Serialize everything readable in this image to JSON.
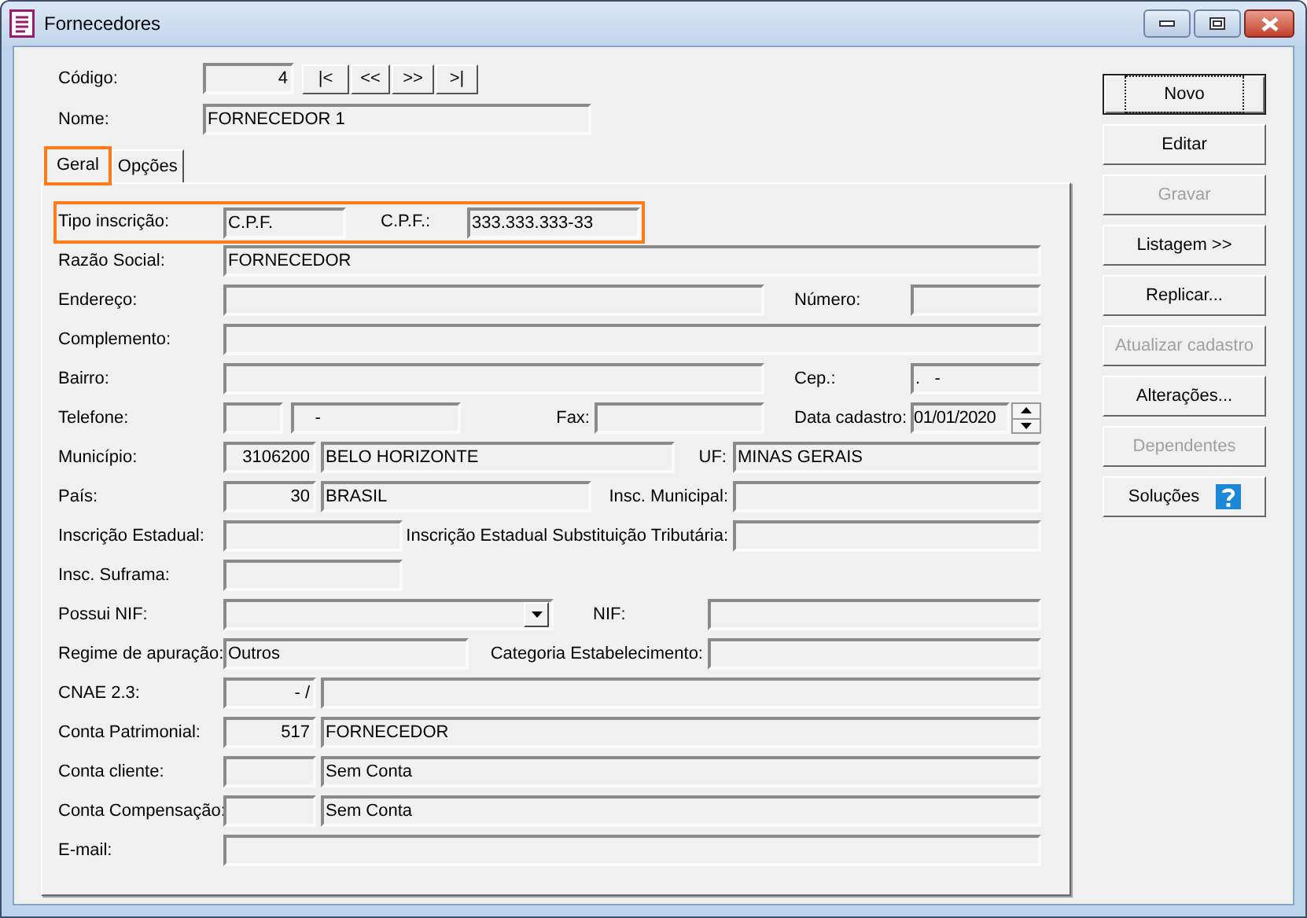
{
  "window": {
    "title": "Fornecedores"
  },
  "header": {
    "codigo_label": "Código:",
    "codigo": "4",
    "nav_buttons": [
      "|<",
      "<<",
      ">>",
      ">|"
    ],
    "nome_label": "Nome:",
    "nome": "FORNECEDOR 1"
  },
  "tabs": [
    {
      "label": "Geral",
      "selected": true,
      "highlighted": true
    },
    {
      "label": "Opções",
      "selected": false,
      "highlighted": false
    }
  ],
  "rows": [
    {
      "highlighted": true,
      "items": [
        {
          "kind": "label",
          "text": "Tipo inscrição:"
        },
        {
          "kind": "field",
          "value": "C.P.F."
        },
        {
          "kind": "label",
          "text": "C.P.F.:"
        },
        {
          "kind": "field",
          "value": "333.333.333-33"
        }
      ]
    },
    {
      "highlighted": false,
      "items": [
        {
          "kind": "label",
          "text": "Razão Social:"
        },
        {
          "kind": "field",
          "value": "FORNECEDOR"
        }
      ]
    },
    {
      "highlighted": false,
      "items": [
        {
          "kind": "label",
          "text": "Endereço:"
        },
        {
          "kind": "field"
        },
        {
          "kind": "label",
          "text": "Número:"
        },
        {
          "kind": "field"
        }
      ]
    },
    {
      "highlighted": false,
      "items": [
        {
          "kind": "label",
          "text": "Complemento:"
        },
        {
          "kind": "field"
        }
      ]
    },
    {
      "highlighted": false,
      "items": [
        {
          "kind": "label",
          "text": "Bairro:"
        },
        {
          "kind": "field"
        },
        {
          "kind": "label",
          "text": "Cep.:"
        },
        {
          "kind": "field",
          "value": ".   -"
        }
      ]
    },
    {
      "highlighted": false,
      "items": [
        {
          "kind": "label",
          "text": "Telefone:"
        },
        {
          "kind": "field"
        },
        {
          "kind": "field",
          "value": "    -"
        },
        {
          "kind": "label",
          "text": "Fax:"
        },
        {
          "kind": "field"
        },
        {
          "kind": "label",
          "text": "Data cadastro:"
        },
        {
          "kind": "date",
          "value": "01/01/2020"
        }
      ]
    },
    {
      "highlighted": false,
      "items": [
        {
          "kind": "label",
          "text": "Município:"
        },
        {
          "kind": "code",
          "value": "3106200"
        },
        {
          "kind": "field",
          "value": "BELO HORIZONTE"
        },
        {
          "kind": "label",
          "text": "UF:"
        },
        {
          "kind": "field",
          "value": "MINAS GERAIS"
        }
      ]
    },
    {
      "highlighted": false,
      "items": [
        {
          "kind": "label",
          "text": "País:"
        },
        {
          "kind": "code",
          "value": "30"
        },
        {
          "kind": "field",
          "value": "BRASIL"
        },
        {
          "kind": "label",
          "text": "Insc. Municipal:"
        },
        {
          "kind": "field"
        }
      ]
    },
    {
      "highlighted": false,
      "items": [
        {
          "kind": "label",
          "text": "Inscrição Estadual:"
        },
        {
          "kind": "field"
        },
        {
          "kind": "label",
          "text": "Inscrição Estadual Substituição Tributária:"
        },
        {
          "kind": "field"
        }
      ]
    },
    {
      "highlighted": false,
      "items": [
        {
          "kind": "label",
          "text": "Insc. Suframa:"
        },
        {
          "kind": "field"
        }
      ]
    },
    {
      "highlighted": false,
      "items": [
        {
          "kind": "label",
          "text": "Possui NIF:"
        },
        {
          "kind": "combo"
        },
        {
          "kind": "label",
          "text": "NIF:"
        },
        {
          "kind": "field"
        }
      ]
    },
    {
      "highlighted": false,
      "items": [
        {
          "kind": "label",
          "text": "Regime de apuração:"
        },
        {
          "kind": "field",
          "value": "Outros"
        },
        {
          "kind": "label",
          "text": "Categoria Estabelecimento:"
        },
        {
          "kind": "field"
        }
      ]
    },
    {
      "highlighted": false,
      "items": [
        {
          "kind": "label",
          "text": "CNAE 2.3:"
        },
        {
          "kind": "code",
          "value": "- /"
        },
        {
          "kind": "field"
        }
      ]
    },
    {
      "highlighted": false,
      "items": [
        {
          "kind": "label",
          "text": "Conta Patrimonial:"
        },
        {
          "kind": "code",
          "value": "517"
        },
        {
          "kind": "field",
          "value": "FORNECEDOR"
        }
      ]
    },
    {
      "highlighted": false,
      "items": [
        {
          "kind": "label",
          "text": "Conta cliente:"
        },
        {
          "kind": "code"
        },
        {
          "kind": "field",
          "value": "Sem Conta"
        }
      ]
    },
    {
      "highlighted": false,
      "items": [
        {
          "kind": "label",
          "text": "Conta Compensação:"
        },
        {
          "kind": "code"
        },
        {
          "kind": "field",
          "value": "Sem Conta"
        }
      ]
    },
    {
      "highlighted": false,
      "items": [
        {
          "kind": "label",
          "text": "E-mail:"
        },
        {
          "kind": "field"
        }
      ]
    }
  ],
  "buttons": [
    {
      "label": "Novo",
      "kind": "plain",
      "disabled": false,
      "focused": true
    },
    {
      "label": "Editar",
      "kind": "plain",
      "disabled": false,
      "focused": false
    },
    {
      "label": "Gravar",
      "kind": "plain",
      "disabled": true,
      "focused": false
    },
    {
      "label": "Listagem >>",
      "kind": "plain",
      "disabled": false,
      "focused": false
    },
    {
      "label": "Replicar...",
      "kind": "plain",
      "disabled": false,
      "focused": false
    },
    {
      "label": "Atualizar cadastro",
      "kind": "plain",
      "disabled": true,
      "focused": false
    },
    {
      "label": "Alterações...",
      "kind": "plain",
      "disabled": false,
      "focused": false
    },
    {
      "label": "Dependentes",
      "kind": "plain",
      "disabled": true,
      "focused": false
    },
    {
      "label": "Soluções",
      "kind": "help",
      "disabled": false,
      "focused": false
    }
  ]
}
